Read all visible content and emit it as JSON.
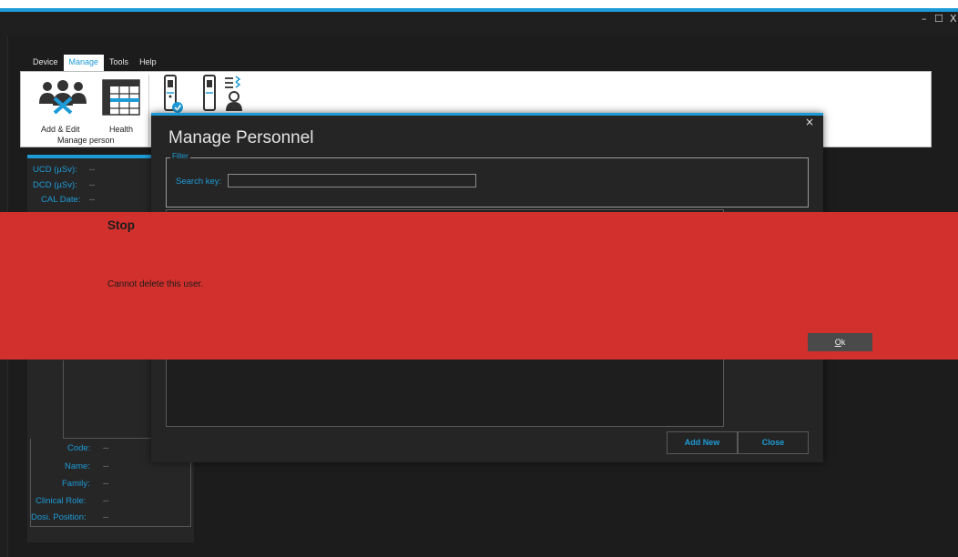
{
  "window": {
    "controls": {
      "minimize": "–",
      "maximize": "☐",
      "close": "X"
    }
  },
  "menu": {
    "items": [
      "Device",
      "Manage",
      "Tools",
      "Help"
    ],
    "active": "Manage"
  },
  "ribbon": {
    "add_edit_label": "Add & Edit",
    "health_label": "Health",
    "group_label": "Manage person"
  },
  "left_panel": {
    "ucd_label": "UCD (µSv):",
    "ucd_value": "--",
    "dcd_label": "DCD (µSv):",
    "dcd_value": "--",
    "cal_label": "CAL Date:",
    "cal_value": "--",
    "code_label": "Code:",
    "code_value": "--",
    "name_label": "Name:",
    "name_value": "--",
    "family_label": "Family:",
    "family_value": "--",
    "clinical_role_label": "Clinical Role:",
    "clinical_role_value": "--",
    "dosi_position_label": "Dosi. Position:",
    "dosi_position_value": "--"
  },
  "dialog": {
    "title": "Manage Personnel",
    "close_glyph": "×",
    "filter_legend": "Filter",
    "search_label": "Search key:",
    "search_value": "",
    "add_new_label": "Add New",
    "close_label": "Close"
  },
  "stop": {
    "title": "Stop",
    "message": "Cannot delete this user.",
    "ok_mnemonic": "O",
    "ok_rest": "k"
  },
  "colors": {
    "accent": "#1d9bd7",
    "stop_background": "#d2302c",
    "app_background": "#1f1f1f"
  }
}
